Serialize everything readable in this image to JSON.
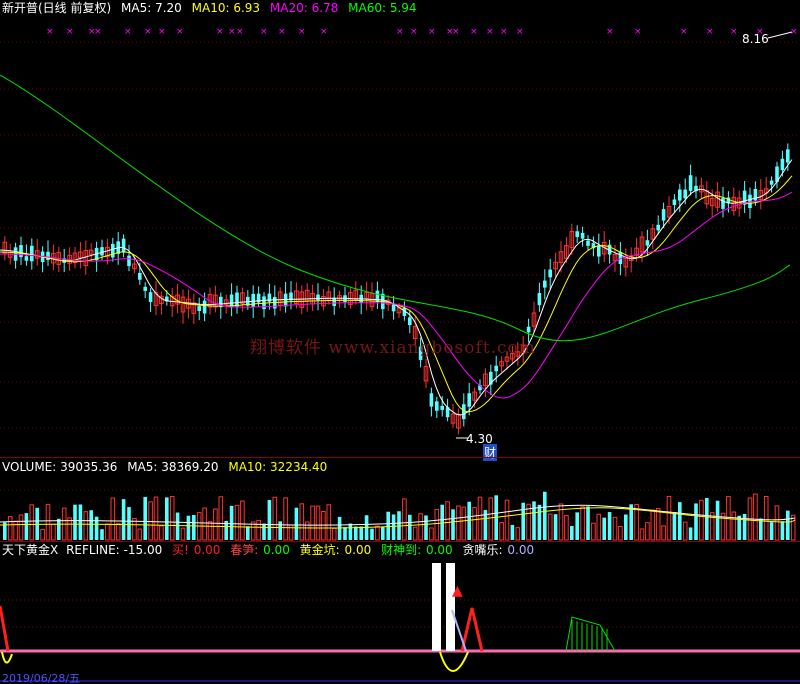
{
  "main_header": {
    "stock": "新开普(日线 前复权)",
    "ma5": "MA5: 7.20",
    "ma10": "MA10: 6.93",
    "ma20": "MA20: 6.78",
    "ma60": "MA60: 5.94"
  },
  "price_annotations": {
    "high": "8.16",
    "low": "4.30",
    "signal": "财"
  },
  "watermark": "翔博软件 www.xiangbosoft.com",
  "volume_header": {
    "volume": "VOLUME: 39035.36",
    "ma5": "MA5: 38369.20",
    "ma10": "MA10: 32234.40"
  },
  "indicator_header": {
    "name": "天下黄金X",
    "refline": "REFLINE: -15.00",
    "buy_label": "买!",
    "buy_value": "0.00",
    "chunsun_label": "春笋:",
    "chunsun_value": "0.00",
    "huangjinkeng_label": "黄金坑:",
    "huangjinkeng_value": "0.00",
    "caishendao_label": "财神到:",
    "caishendao_value": "0.00",
    "tanzuile_label": "贪嘴乐:",
    "tanzuile_value": "0.00"
  },
  "date_label": "2019/06/28/五",
  "colors": {
    "background": "#000000",
    "up_candle": "#ff3232",
    "down_candle": "#54ffff",
    "ma5": "#ffffff",
    "ma10": "#ffff00",
    "ma20": "#ff00ff",
    "ma60": "#00e000",
    "separator": "#8b0000"
  },
  "chart_data": {
    "type": "candlestick",
    "title": "新开普(日线 前复权)",
    "series": [
      {
        "name": "MA5",
        "last": 7.2
      },
      {
        "name": "MA10",
        "last": 6.93
      },
      {
        "name": "MA20",
        "last": 6.78
      },
      {
        "name": "MA60",
        "last": 5.94
      }
    ],
    "annotations": [
      {
        "label": "8.16",
        "kind": "high"
      },
      {
        "label": "4.30",
        "kind": "low"
      }
    ],
    "volume": {
      "value": 39035.36,
      "ma5": 38369.2,
      "ma10": 32234.4
    },
    "indicator": {
      "name": "天下黄金X",
      "refline": -15.0
    }
  }
}
